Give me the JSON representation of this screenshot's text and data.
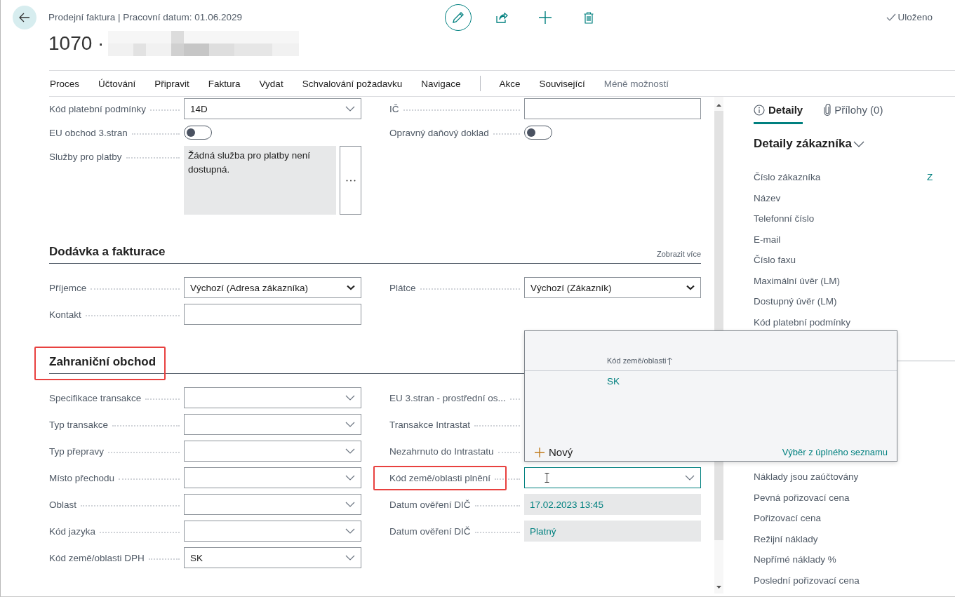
{
  "header": {
    "subtitle": "Prodejní faktura | Pracovní datum: 01.06.2029",
    "record_number": "1070 ·",
    "save_status": "Uloženo"
  },
  "action_bar": {
    "items": [
      {
        "label": "Proces"
      },
      {
        "label": "Účtování"
      },
      {
        "label": "Připravit"
      },
      {
        "label": "Faktura"
      },
      {
        "label": "Vydat"
      },
      {
        "label": "Schvalování požadavku"
      },
      {
        "label": "Navigace"
      }
    ],
    "secondary_items": [
      {
        "label": "Akce"
      },
      {
        "label": "Související"
      }
    ],
    "options_toggle": "Méně možností"
  },
  "sections": [
    {
      "rows": [
        {
          "left": {
            "label": "Kód platební podmínky",
            "field": {
              "kind": "dropdown",
              "value": "14D"
            }
          },
          "right": {
            "label": "IČ",
            "field": {
              "kind": "input"
            }
          }
        },
        {
          "left": {
            "label": "EU obchod 3.stran",
            "field": {
              "kind": "toggle",
              "on": false
            }
          },
          "right": {
            "label": "Opravný daňový doklad",
            "field": {
              "kind": "toggle",
              "on": false
            }
          }
        },
        {
          "left": {
            "label": "Služby pro platby",
            "field": {
              "kind": "memo",
              "value": "Žádná služba pro platby není dostupná."
            }
          }
        }
      ]
    },
    {
      "title": "Dodávka a fakturace",
      "show_more": "Zobrazit více",
      "rows": [
        {
          "left": {
            "label": "Příjemce",
            "field": {
              "kind": "select",
              "value": "Výchozí (Adresa zákazníka)"
            }
          },
          "right": {
            "label": "Plátce",
            "field": {
              "kind": "select",
              "value": "Výchozí (Zákazník)"
            }
          }
        },
        {
          "left": {
            "label": "Kontakt",
            "field": {
              "kind": "input"
            }
          }
        }
      ]
    },
    {
      "title": "Zahraniční obchod",
      "highlighted": true,
      "rows": [
        {
          "left": {
            "label": "Specifikace transakce",
            "field": {
              "kind": "dropdown"
            }
          },
          "right": {
            "label": "EU 3.stran - prostřední os..."
          }
        },
        {
          "left": {
            "label": "Typ transakce",
            "field": {
              "kind": "dropdown"
            }
          },
          "right": {
            "label": "Transakce Intrastat"
          }
        },
        {
          "left": {
            "label": "Typ přepravy",
            "field": {
              "kind": "dropdown"
            }
          },
          "right": {
            "label": "Nezahrnuto do Intrastatu"
          }
        },
        {
          "left": {
            "label": "Místo přechodu",
            "field": {
              "kind": "dropdown"
            }
          },
          "right": {
            "label": "Kód země/oblasti plnění",
            "highlighted": true,
            "field": {
              "kind": "dropdown",
              "focused": true
            }
          }
        },
        {
          "left": {
            "label": "Oblast",
            "field": {
              "kind": "dropdown"
            }
          },
          "right": {
            "label": "Datum ověření DIČ",
            "field": {
              "kind": "readonly",
              "value": "17.02.2023 13:45"
            }
          }
        },
        {
          "left": {
            "label": "Kód jazyka",
            "field": {
              "kind": "dropdown"
            }
          },
          "right": {
            "label": "Datum ověření DIČ",
            "field": {
              "kind": "readonly",
              "value": "Platný"
            }
          }
        },
        {
          "left": {
            "label": "Kód země/oblasti DPH",
            "field": {
              "kind": "dropdown",
              "value": "SK"
            }
          }
        }
      ]
    }
  ],
  "lookup_popup": {
    "column": "Kód země/oblasti",
    "sort_ascending": true,
    "rows": [
      {
        "value": "SK"
      }
    ],
    "new_action": "Nový",
    "full_list_link": "Výběr z úplného seznamu"
  },
  "factbox": {
    "tabs": [
      {
        "label": "Detaily",
        "selected": true
      },
      {
        "label": "Přílohy (0)",
        "selected": false
      }
    ],
    "heading": "Detaily zákazníka",
    "details": [
      {
        "label": "Číslo zákazníka",
        "value": "Z"
      },
      {
        "label": "Název"
      },
      {
        "label": "Telefonní číslo"
      },
      {
        "label": "E-mail"
      },
      {
        "label": "Číslo faxu"
      },
      {
        "label": "Maximální úvěr (LM)"
      },
      {
        "label": "Dostupný úvěr (LM)"
      },
      {
        "label": "Kód platební podmínky"
      }
    ],
    "cost_rows": [
      {
        "label": "Náklady jsou zaúčtovány"
      },
      {
        "label": "Pevná pořizovací cena"
      },
      {
        "label": "Pořizovací cena"
      },
      {
        "label": "Režijní náklady"
      },
      {
        "label": "Nepřímé náklady %"
      },
      {
        "label": "Poslední pořizovací cena"
      }
    ]
  }
}
